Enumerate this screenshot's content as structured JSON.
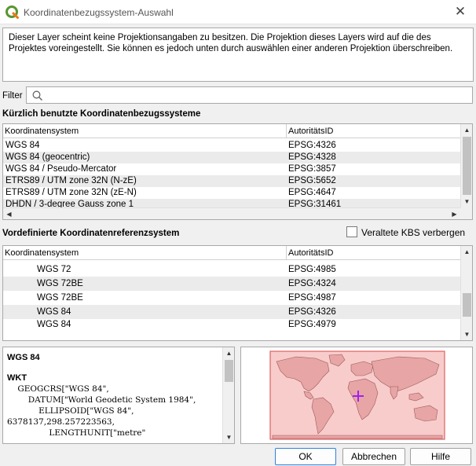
{
  "window": {
    "title": "Koordinatenbezugssystem-Auswahl",
    "app_icon": "qgis-logo-icon",
    "close_glyph": "✕"
  },
  "info_text": "Dieser Layer scheint keine Projektionsangaben zu besitzen. Die Projektion dieses Layers wird auf die des Projektes voreingestellt. Sie können es jedoch unten durch auswählen einer anderen Projektion überschreiben.",
  "filter": {
    "label": "Filter",
    "value": "",
    "icon": "search-icon"
  },
  "recent": {
    "title": "Kürzlich benutzte Koordinatenbezugssysteme",
    "columns": [
      "Koordinatensystem",
      "AutoritätsID"
    ],
    "rows": [
      {
        "name": "WGS 84",
        "id": "EPSG:4326"
      },
      {
        "name": "WGS 84 (geocentric)",
        "id": "EPSG:4328"
      },
      {
        "name": "WGS 84 / Pseudo-Mercator",
        "id": "EPSG:3857"
      },
      {
        "name": "ETRS89 / UTM zone 32N (N-zE)",
        "id": "EPSG:5652"
      },
      {
        "name": "ETRS89 / UTM zone 32N (zE-N)",
        "id": "EPSG:4647"
      },
      {
        "name": "DHDN / 3-degree Gauss zone 1",
        "id": "EPSG:31461"
      }
    ]
  },
  "predefined": {
    "title": "Vordefinierte Koordinatenreferenzsystem",
    "hide_deprecated_label": "Veraltete KBS verbergen",
    "hide_deprecated_checked": false,
    "columns": [
      "Koordinatensystem",
      "AutoritätsID"
    ],
    "rows": [
      {
        "name": "WGS 72",
        "id": "EPSG:4985"
      },
      {
        "name": "WGS 72BE",
        "id": "EPSG:4324"
      },
      {
        "name": "WGS 72BE",
        "id": "EPSG:4987"
      },
      {
        "name": "WGS 84",
        "id": "EPSG:4326"
      },
      {
        "name": "WGS 84",
        "id": "EPSG:4979"
      }
    ]
  },
  "details": {
    "name": "WGS 84",
    "wkt_heading": "WKT",
    "wkt_text": "    GEOGCRS[\"WGS 84\",\n        DATUM[\"World Geodetic System 1984\",\n            ELLIPSOID[\"WGS 84\",\n6378137,298.257223563,\n                LENGTHUNIT[\"metre\""
  },
  "map": {
    "extent_fill": "#f4a3a3",
    "extent_stroke": "#e06060",
    "marker_color": "#a020f0",
    "marker_icon": "crosshair-icon"
  },
  "buttons": {
    "ok": "OK",
    "cancel": "Abbrechen",
    "help": "Hilfe"
  }
}
